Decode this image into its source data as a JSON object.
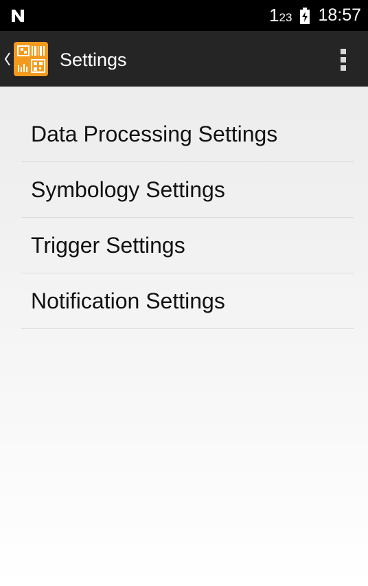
{
  "status_bar": {
    "notification_icon": "n-notification-icon",
    "keyboard_indicator_big": "1",
    "keyboard_indicator_small": "23",
    "battery_icon": "battery-charging-icon",
    "time": "18:57"
  },
  "action_bar": {
    "back_icon": "chevron-left-icon",
    "app_icon": "barcode-scanner-app-icon",
    "title": "Settings",
    "menu_icon": "overflow-menu-icon"
  },
  "settings": {
    "items": [
      {
        "label": "Data Processing Settings"
      },
      {
        "label": "Symbology Settings"
      },
      {
        "label": "Trigger Settings"
      },
      {
        "label": "Notification Settings"
      }
    ]
  },
  "colors": {
    "status_bar": "#000000",
    "action_bar": "#252525",
    "app_icon_accent": "#f39a1e",
    "divider": "#dcdcdc",
    "text": "#111111"
  }
}
